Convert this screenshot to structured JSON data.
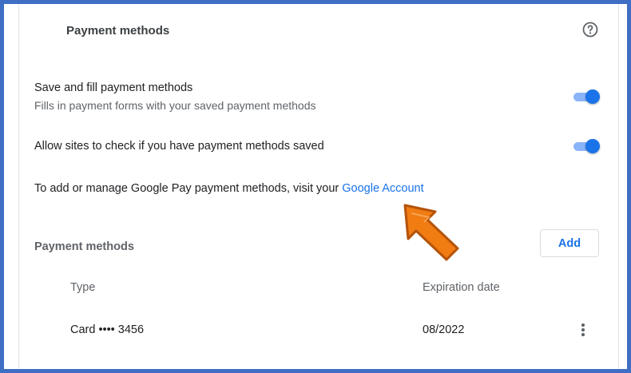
{
  "section": {
    "title": "Payment methods",
    "help_icon": "help-circle-icon"
  },
  "settings": {
    "save_fill": {
      "title": "Save and fill payment methods",
      "subtitle": "Fills in payment forms with your saved payment methods",
      "enabled": true
    },
    "allow_check": {
      "title": "Allow sites to check if you have payment methods saved",
      "enabled": true
    },
    "google_pay": {
      "text": "To add or manage Google Pay payment methods, visit your ",
      "link_text": "Google Account"
    }
  },
  "payment_list": {
    "label": "Payment methods",
    "add_label": "Add",
    "columns": [
      "Type",
      "Expiration date"
    ],
    "rows": [
      {
        "type": "Card •••• 3456",
        "expiration": "08/2022",
        "menu_icon": "more-vert-icon"
      }
    ]
  },
  "annotation": {
    "icon": "orange-arrow-icon"
  },
  "colors": {
    "accent": "#1a73e8",
    "toggle_track": "#8ab4f8",
    "frame_border": "#3f6fc4",
    "arrow": "#f07c12"
  }
}
